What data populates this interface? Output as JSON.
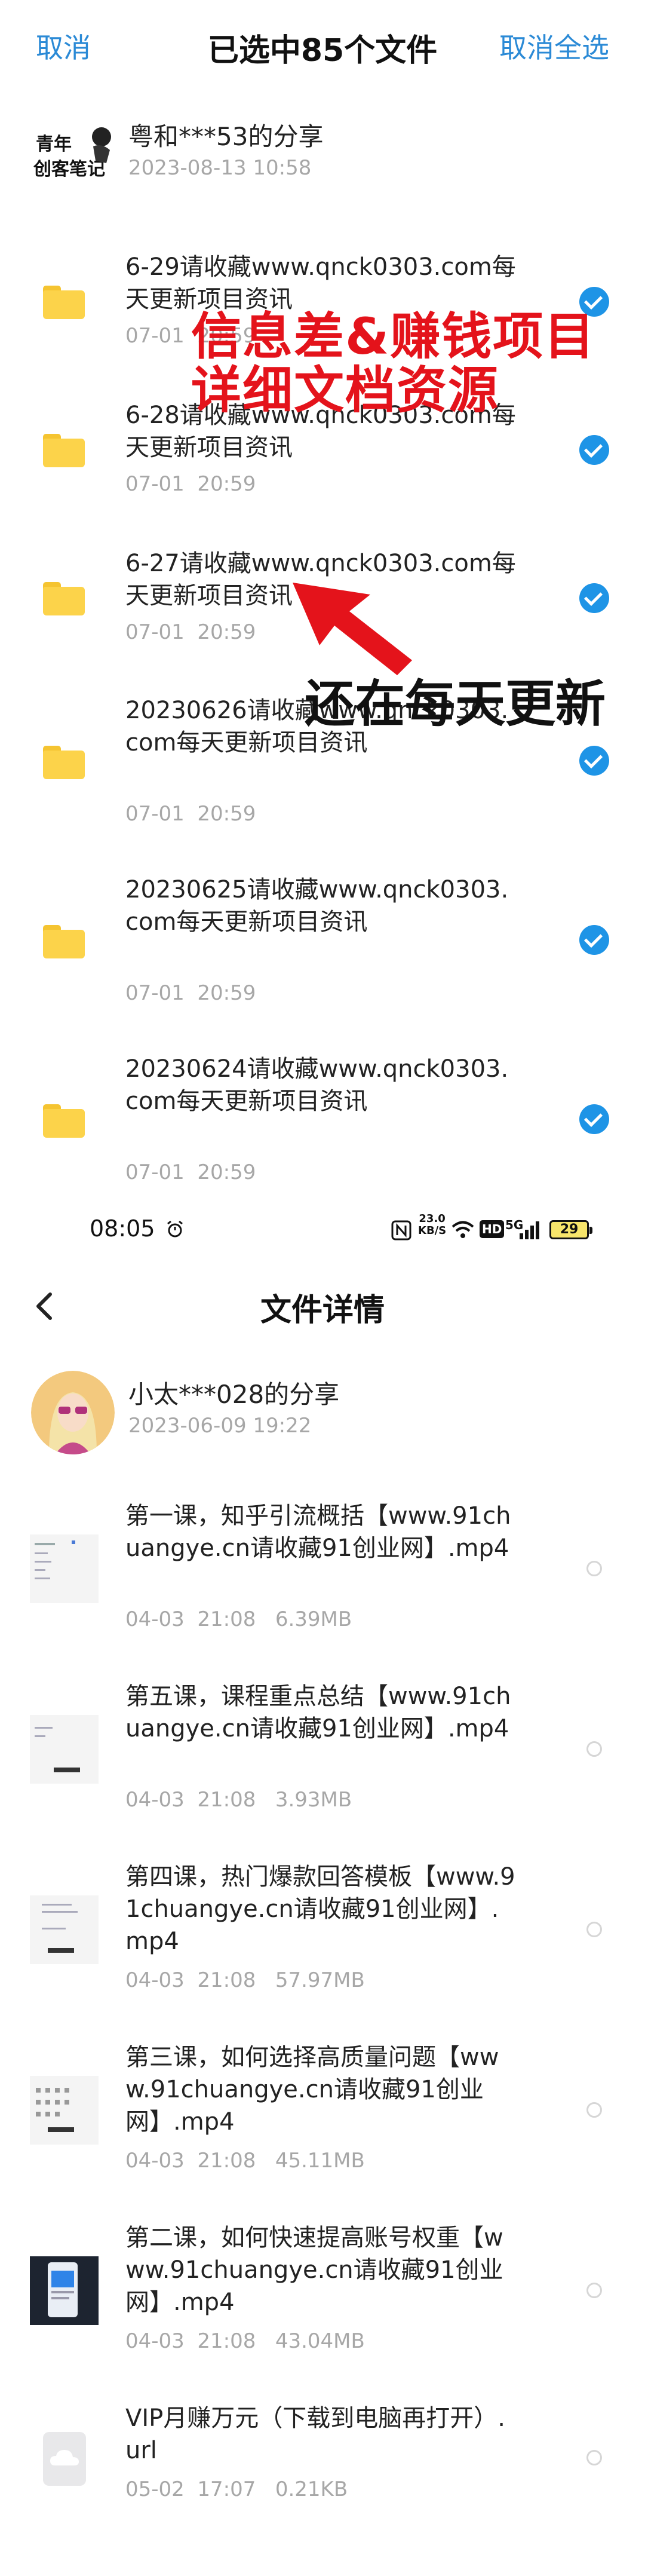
{
  "topbar": {
    "cancel": "取消",
    "title": "已选中85个文件",
    "deselect_all": "取消全选"
  },
  "sharer1": {
    "name": "粤和***53的分享",
    "date": "2023-08-13  10:58",
    "logo_text": "青年 创客笔记"
  },
  "files1": [
    {
      "name": "6-29请收藏www.qnck0303.com每天更新项目资讯",
      "meta": "07-01  20:59"
    },
    {
      "name": "6-28请收藏www.qnck0303.com每天更新项目资讯",
      "meta": "07-01  20:59"
    },
    {
      "name": "6-27请收藏www.qnck0303.com每天更新项目资讯",
      "meta": "07-01  20:59"
    },
    {
      "name": "20230626请收藏www.qnck0303.com每天更新项目资讯",
      "meta": "07-01  20:59"
    },
    {
      "name": "20230625请收藏www.qnck0303.com每天更新项目资讯",
      "meta": "07-01  20:59"
    },
    {
      "name": "20230624请收藏www.qnck0303.com每天更新项目资讯",
      "meta": "07-01  20:59"
    }
  ],
  "overlay": {
    "line1": "信息差&赚钱项目",
    "line2": "详细文档资源",
    "line3": "还在每天更新",
    "red": "#e4131b"
  },
  "statusbar": {
    "time": "08:05",
    "speed_value": "23.0",
    "speed_unit": "KB/S",
    "hd": "HD",
    "net": "5G",
    "battery": "29"
  },
  "detail": {
    "back_icon": "chevron-left-icon",
    "title": "文件详情"
  },
  "sharer2": {
    "name": "小太***028的分享",
    "date": "2023-06-09  19:22"
  },
  "files2": [
    {
      "name": "第一课，知乎引流概括【www.91chuangye.cn请收藏91创业网】.mp4",
      "meta": "04-03  21:08   6.39MB"
    },
    {
      "name": "第五课，课程重点总结【www.91chuangye.cn请收藏91创业网】.mp4",
      "meta": "04-03  21:08   3.93MB"
    },
    {
      "name": "第四课，热门爆款回答模板【www.91chuangye.cn请收藏91创业网】.mp4",
      "meta": "04-03  21:08   57.97MB"
    },
    {
      "name": "第三课，如何选择高质量问题【www.91chuangye.cn请收藏91创业网】.mp4",
      "meta": "04-03  21:08   45.11MB"
    },
    {
      "name": "第二课，如何快速提高账号权重【www.91chuangye.cn请收藏91创业网】.mp4",
      "meta": "04-03  21:08   43.04MB"
    },
    {
      "name": "VIP月赚万元（下载到电脑再打开）.url",
      "meta": "05-02  17:07   0.21KB"
    }
  ],
  "colors": {
    "accent": "#2b8ad6",
    "check": "#1e94e6",
    "folder": "#fcd34a",
    "meta_text": "#a7a7a7"
  }
}
